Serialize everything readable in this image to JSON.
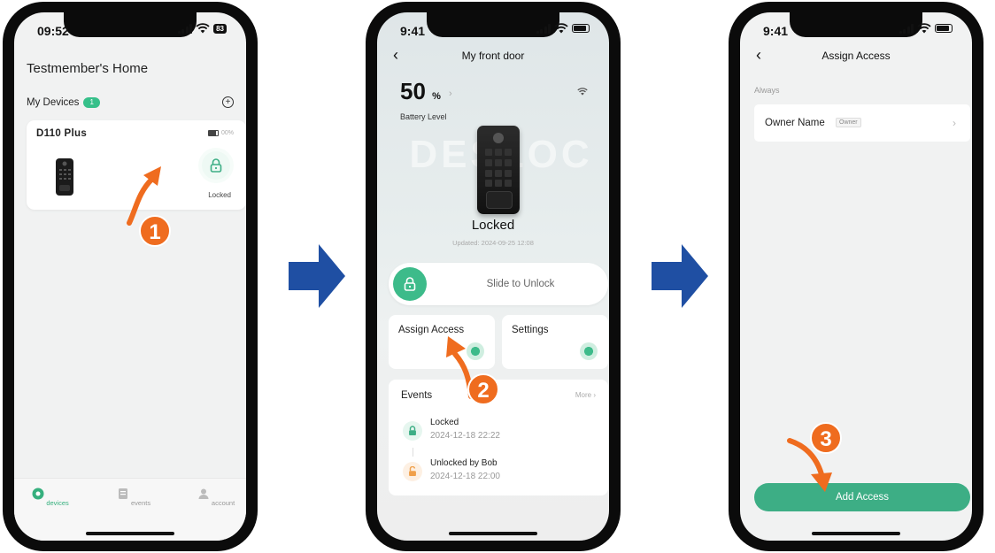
{
  "colors": {
    "accent": "#3dae85",
    "step_badge": "#ef6c1f",
    "flow_arrow": "#1f4fa3"
  },
  "steps": [
    "1",
    "2",
    "3"
  ],
  "phone1": {
    "time": "09:52",
    "battery": "83",
    "home_title": "Testmember's Home",
    "devices_label": "My Devices",
    "devices_count": "1",
    "device": {
      "name": "D110 Plus",
      "battery": "00%",
      "status": "Locked"
    },
    "tabs": [
      {
        "label": "devices",
        "icon": "devices-icon"
      },
      {
        "label": "events",
        "icon": "events-icon"
      },
      {
        "label": "account",
        "icon": "account-icon"
      }
    ]
  },
  "phone2": {
    "time": "9:41",
    "title": "My front door",
    "battery_value": "50",
    "battery_unit": "%",
    "battery_label": "Battery Level",
    "watermark": "DESLOC",
    "status": "Locked",
    "updated": "Updated: 2024-09-25 12:08",
    "slide_label": "Slide to Unlock",
    "assign_label": "Assign Access",
    "settings_label": "Settings",
    "events_title": "Events",
    "events_more": "More",
    "events": [
      {
        "name": "Locked",
        "time": "2024-12-18 22:22",
        "icon": "lock-icon"
      },
      {
        "name": "Unlocked by Bob",
        "time": "2024-12-18 22:00",
        "icon": "unlock-icon"
      }
    ]
  },
  "phone3": {
    "time": "9:41",
    "title": "Assign Access",
    "section": "Always",
    "owner_name": "Owner Name",
    "owner_tag": "Owner",
    "add_button": "Add Access"
  }
}
